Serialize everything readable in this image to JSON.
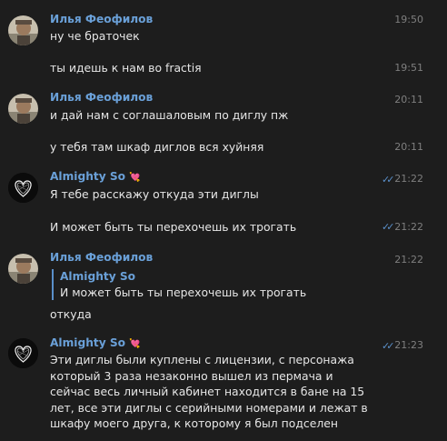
{
  "users": {
    "ilya": "Илья Феофилов",
    "almighty": "Almighty So",
    "almighty_emoji": "💘"
  },
  "messages": [
    {
      "text": "ну че браточек",
      "time": "19:50"
    },
    {
      "text": "ты идешь к нам во fractiя",
      "time": "19:51"
    },
    {
      "text": "и дай нам с соглашаловым по диглу пж",
      "time": "20:11"
    },
    {
      "text": "у тебя там шкаф диглов вся хуйняя",
      "time": "20:11"
    },
    {
      "text": "Я тебе расскажу откуда эти диглы",
      "time": "21:22"
    },
    {
      "text": "И может быть ты перехочешь их трогать",
      "time": "21:22"
    },
    {
      "text": "откуда",
      "time": "21:22",
      "reply_name": "Almighty So",
      "reply_text": "И может быть ты перехочешь их трогать"
    },
    {
      "text": "Эти диглы были куплены с лицензии, с персонажа который 3 раза незаконно вышел из пермача и сейчас весь личный кабинет находится в бане на 15 лет, все эти диглы с серийными номерами и лежат в шкафу моего друга, к которому я был подселен",
      "time": "21:23"
    }
  ],
  "icons": {
    "read_receipt": "double-check-icon",
    "avatar_ilya": "user-photo-avatar",
    "avatar_almighty": "heart-scribble-avatar"
  },
  "colors": {
    "background": "#1d1d1d",
    "name": "#6aa0d8",
    "text": "#e6e6e6",
    "time": "#7f7f7f",
    "check": "#5a8fc9"
  }
}
